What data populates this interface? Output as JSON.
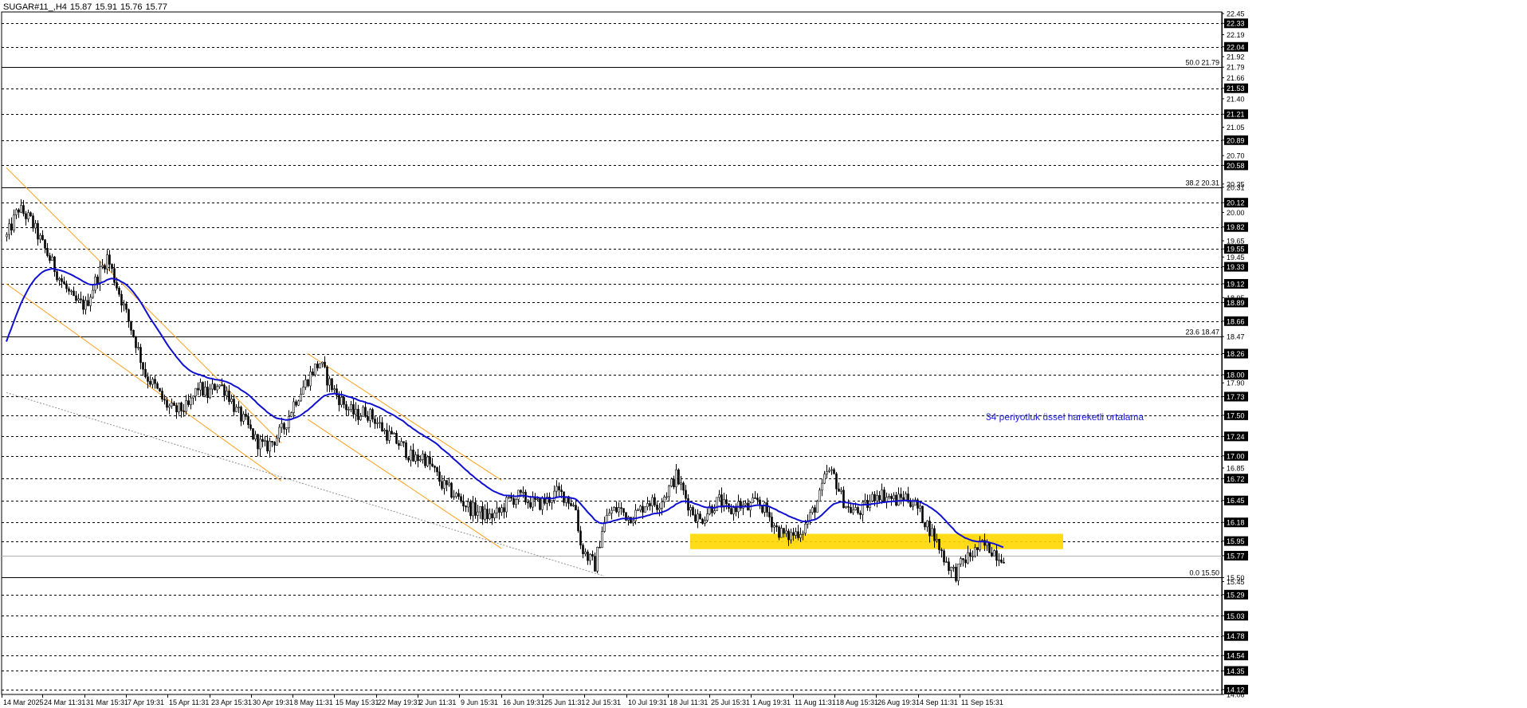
{
  "header": {
    "symbol": "SUGAR#11_,H4",
    "open": "15.87",
    "high": "15.91",
    "low": "15.76",
    "close": "15.77"
  },
  "colors": {
    "background": "#ffffff",
    "candle": "#000000",
    "ema": "#1010d0",
    "channel": "#ffa020",
    "zone": "#ffd700",
    "grid": "#000000",
    "annotation": "#1818e0"
  },
  "chart_data": {
    "type": "candlestick",
    "title": "",
    "xlabel": "",
    "ylabel": "",
    "ylim": [
      14.06,
      22.47
    ],
    "y_ticks": [
      "22.45",
      "22.33",
      "22.19",
      "22.04",
      "21.92",
      "21.79",
      "21.66",
      "21.53",
      "21.40",
      "21.21",
      "21.05",
      "20.89",
      "20.70",
      "20.58",
      "20.35",
      "20.31",
      "20.12",
      "20.00",
      "19.82",
      "19.65",
      "19.55",
      "19.45",
      "19.33",
      "19.12",
      "18.95",
      "18.89",
      "18.66",
      "18.47",
      "18.26",
      "17.90",
      "18.00",
      "17.73",
      "17.50",
      "17.24",
      "17.00",
      "16.85",
      "16.72",
      "16.45",
      "16.18",
      "15.95",
      "15.77",
      "15.50",
      "15.45",
      "15.29",
      "15.03",
      "14.78",
      "14.54",
      "14.35",
      "14.12",
      "14.06"
    ],
    "y_tick_values": [
      22.45,
      22.33,
      22.19,
      22.04,
      21.92,
      21.79,
      21.66,
      21.53,
      21.4,
      21.21,
      21.05,
      20.89,
      20.7,
      20.58,
      20.35,
      20.31,
      20.12,
      20.0,
      19.82,
      19.65,
      19.55,
      19.45,
      19.33,
      19.12,
      18.95,
      18.89,
      18.66,
      18.47,
      18.26,
      17.9,
      18.0,
      17.73,
      17.5,
      17.24,
      17.0,
      16.85,
      16.72,
      16.45,
      16.18,
      15.95,
      15.77,
      15.5,
      15.45,
      15.29,
      15.03,
      14.78,
      14.54,
      14.35,
      14.12,
      14.06
    ],
    "boxed_ticks": [
      "22.33",
      "22.04",
      "21.53",
      "21.21",
      "20.89",
      "20.58",
      "20.12",
      "19.82",
      "19.55",
      "19.33",
      "19.12",
      "18.89",
      "18.66",
      "18.26",
      "18.00",
      "17.73",
      "17.50",
      "17.24",
      "17.00",
      "16.72",
      "16.45",
      "16.18",
      "15.95",
      "15.77",
      "15.29",
      "15.03",
      "14.78",
      "14.54",
      "14.35",
      "14.12"
    ],
    "dashed_levels": [
      22.33,
      22.04,
      21.53,
      21.21,
      20.89,
      20.58,
      20.12,
      19.82,
      19.55,
      19.33,
      19.12,
      18.89,
      18.66,
      18.26,
      18.0,
      17.73,
      17.5,
      17.24,
      17.0,
      16.72,
      16.45,
      16.18,
      15.95,
      15.29,
      15.03,
      14.78,
      14.54,
      14.35,
      14.12
    ],
    "current_price": 15.77,
    "x_labels": [
      "14 Mar 2025",
      "24 Mar 11:31",
      "31 Mar 15:31",
      "7 Apr 19:31",
      "15 Apr 11:31",
      "23 Apr 15:31",
      "30 Apr 19:31",
      "8 May 11:31",
      "15 May 15:31",
      "22 May 19:31",
      "2 Jun 11:31",
      "9 Jun 15:31",
      "16 Jun 19:31",
      "25 Jun 11:31",
      "2 Jul 15:31",
      "10 Jul 19:31",
      "18 Jul 11:31",
      "25 Jul 15:31",
      "1 Aug 19:31",
      "11 Aug 11:31",
      "18 Aug 15:31",
      "26 Aug 19:31",
      "4 Sep 11:31",
      "11 Sep 15:31"
    ],
    "fibonacci": [
      {
        "label": "50.0 21.79",
        "value": 21.79
      },
      {
        "label": "38.2 20.31",
        "value": 20.31
      },
      {
        "label": "23.6 18.47",
        "value": 18.47
      },
      {
        "label": "0.0 15.50",
        "value": 15.5
      }
    ],
    "zone": {
      "from_bar": 286,
      "to_bar": 442,
      "low": 15.85,
      "high": 16.04
    },
    "annotation": "34 periyotluk üssel hareketli ortalama",
    "ema_period": 34,
    "channels": [
      {
        "from_bar": 0,
        "from_price": 20.55,
        "to_bar": 115,
        "to_price": 17.16
      },
      {
        "from_bar": 0,
        "from_price": 19.12,
        "to_bar": 115,
        "to_price": 16.69
      },
      {
        "from_bar": 126,
        "from_price": 18.26,
        "to_bar": 207,
        "to_price": 16.7
      },
      {
        "from_bar": 126,
        "from_price": 17.45,
        "to_bar": 207,
        "to_price": 15.86
      }
    ],
    "dotted_trend": {
      "from_bar": 0,
      "from_price": 17.78,
      "to_bar": 250,
      "to_price": 15.52
    },
    "anchors": [
      [
        0,
        19.7
      ],
      [
        5,
        20.05
      ],
      [
        10,
        19.9
      ],
      [
        15,
        19.6
      ],
      [
        22,
        19.2
      ],
      [
        28,
        18.9
      ],
      [
        33,
        18.85
      ],
      [
        37,
        19.15
      ],
      [
        42,
        19.45
      ],
      [
        46,
        19.1
      ],
      [
        50,
        18.75
      ],
      [
        54,
        18.4
      ],
      [
        58,
        18.0
      ],
      [
        62,
        17.85
      ],
      [
        66,
        17.65
      ],
      [
        70,
        17.55
      ],
      [
        76,
        17.6
      ],
      [
        80,
        17.85
      ],
      [
        84,
        17.75
      ],
      [
        88,
        17.9
      ],
      [
        92,
        17.8
      ],
      [
        96,
        17.55
      ],
      [
        100,
        17.4
      ],
      [
        104,
        17.2
      ],
      [
        108,
        17.1
      ],
      [
        112,
        17.2
      ],
      [
        116,
        17.35
      ],
      [
        120,
        17.65
      ],
      [
        124,
        17.85
      ],
      [
        128,
        18.05
      ],
      [
        131,
        18.15
      ],
      [
        134,
        17.95
      ],
      [
        138,
        17.75
      ],
      [
        142,
        17.6
      ],
      [
        146,
        17.5
      ],
      [
        150,
        17.55
      ],
      [
        154,
        17.45
      ],
      [
        158,
        17.3
      ],
      [
        162,
        17.2
      ],
      [
        166,
        17.1
      ],
      [
        170,
        16.95
      ],
      [
        174,
        17.0
      ],
      [
        178,
        16.85
      ],
      [
        182,
        16.65
      ],
      [
        186,
        16.55
      ],
      [
        190,
        16.45
      ],
      [
        194,
        16.35
      ],
      [
        198,
        16.3
      ],
      [
        202,
        16.25
      ],
      [
        206,
        16.3
      ],
      [
        210,
        16.45
      ],
      [
        214,
        16.5
      ],
      [
        218,
        16.45
      ],
      [
        222,
        16.4
      ],
      [
        226,
        16.45
      ],
      [
        230,
        16.55
      ],
      [
        234,
        16.5
      ],
      [
        238,
        16.35
      ],
      [
        240,
        15.9
      ],
      [
        243,
        15.75
      ],
      [
        246,
        15.65
      ],
      [
        249,
        16.1
      ],
      [
        252,
        16.3
      ],
      [
        256,
        16.35
      ],
      [
        260,
        16.25
      ],
      [
        264,
        16.3
      ],
      [
        268,
        16.45
      ],
      [
        272,
        16.4
      ],
      [
        276,
        16.55
      ],
      [
        280,
        16.75
      ],
      [
        283,
        16.55
      ],
      [
        286,
        16.35
      ],
      [
        290,
        16.2
      ],
      [
        294,
        16.35
      ],
      [
        298,
        16.45
      ],
      [
        302,
        16.3
      ],
      [
        306,
        16.4
      ],
      [
        310,
        16.35
      ],
      [
        314,
        16.45
      ],
      [
        318,
        16.3
      ],
      [
        322,
        16.1
      ],
      [
        326,
        16.0
      ],
      [
        330,
        16.05
      ],
      [
        333,
        16.1
      ],
      [
        336,
        16.25
      ],
      [
        340,
        16.5
      ],
      [
        343,
        16.8
      ],
      [
        346,
        16.75
      ],
      [
        349,
        16.5
      ],
      [
        352,
        16.35
      ],
      [
        356,
        16.3
      ],
      [
        360,
        16.4
      ],
      [
        364,
        16.55
      ],
      [
        368,
        16.5
      ],
      [
        372,
        16.45
      ],
      [
        376,
        16.5
      ],
      [
        380,
        16.4
      ],
      [
        384,
        16.2
      ],
      [
        388,
        16.0
      ],
      [
        392,
        15.75
      ],
      [
        395,
        15.6
      ],
      [
        397,
        15.55
      ],
      [
        400,
        15.7
      ],
      [
        404,
        15.8
      ],
      [
        408,
        15.9
      ],
      [
        412,
        15.85
      ],
      [
        415,
        15.77
      ]
    ]
  }
}
